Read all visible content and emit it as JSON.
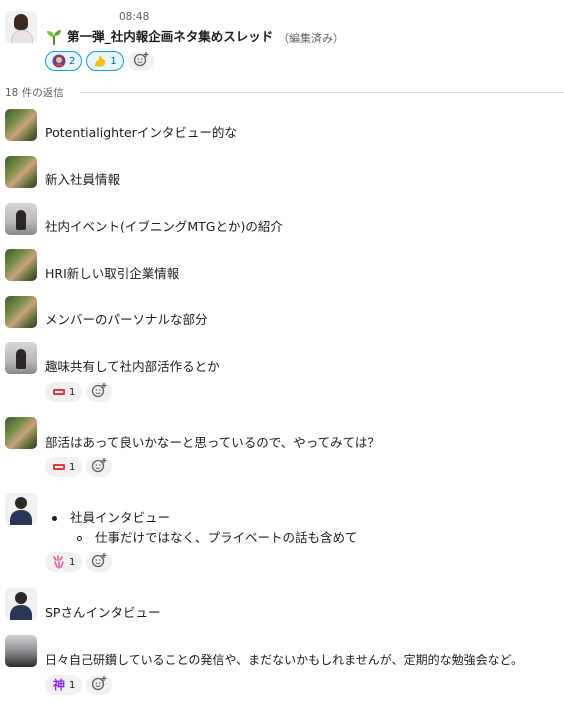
{
  "parent": {
    "time": "08:48",
    "title": "第一弾_社内報企画ネタ集めスレッド",
    "edited": "（編集済み）",
    "reactions": [
      {
        "icon": "purple-avatar-emoji",
        "count": "2",
        "active": true
      },
      {
        "icon": "flexed-biceps-emoji",
        "count": "1",
        "active": true
      }
    ]
  },
  "reply_count": "18 件の返信",
  "replies": [
    {
      "text": "Potentialighterインタビュー的な"
    },
    {
      "text": "新入社員情報"
    },
    {
      "text": "社内イベント(イブニングMTGとか)の紹介"
    },
    {
      "text": "HRI新しい取引企業情報"
    },
    {
      "text": "メンバーのパーソナルな部分"
    },
    {
      "text": "趣味共有して社内部活作るとか",
      "reaction": {
        "icon": "sticker-emoji",
        "count": "1"
      }
    },
    {
      "text": "部活はあって良いかなーと思っているので、やってみては？",
      "reaction": {
        "icon": "sticker-emoji",
        "count": "1"
      }
    },
    {
      "bullet": "社員インタビュー",
      "sub_bullet": "仕事だけではなく、プライベートの話も含めて",
      "reaction": {
        "icon": "confetti-emoji",
        "count": "1"
      }
    },
    {
      "text": "SPさんインタビュー"
    },
    {
      "text": "日々自己研鑽していることの発信や、まだないかもしれませんが、定期的な勉強会など。",
      "reaction": {
        "icon": "kami-kanji-emoji",
        "count": "1",
        "glyph": "神"
      }
    }
  ],
  "colors": {
    "active_reaction_bg": "#e8f5fa",
    "active_reaction_border": "#1d9bd1",
    "text": "#1d1c1d",
    "muted": "#616061"
  }
}
